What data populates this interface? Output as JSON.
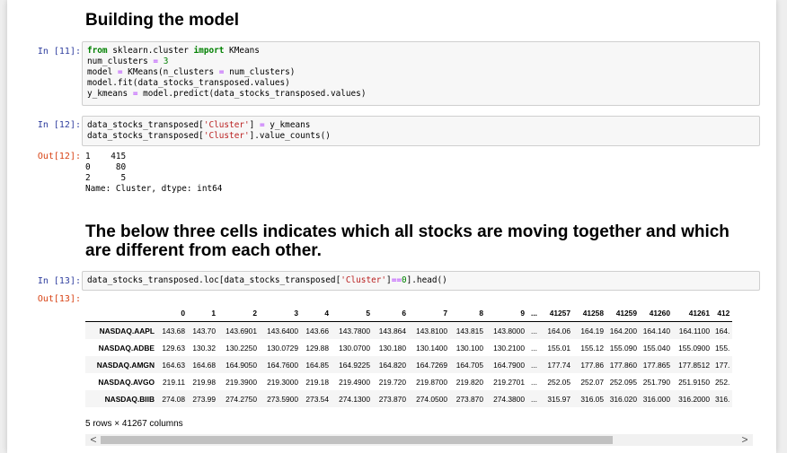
{
  "headings": {
    "building_model": "Building the model",
    "below_three_cells": "The below three cells indicates which all stocks are moving together and which are different from each other."
  },
  "cells": {
    "c11": {
      "prompt": "In [11]:",
      "line1": {
        "kw1": "from",
        "mod": " sklearn.cluster ",
        "kw2": "import",
        "name": " KMeans"
      },
      "line2": {
        "pre": "num_clusters ",
        "op": "=",
        "sp": " ",
        "num": "3"
      },
      "line3": {
        "pre": "model ",
        "op": "=",
        "rest": " KMeans(n_clusters ",
        "op2": "=",
        "rest2": " num_clusters)"
      },
      "line4": "model.fit(data_stocks_transposed.values)",
      "line5": {
        "pre": "y_kmeans ",
        "op": "=",
        "rest": " model.predict(data_stocks_transposed.values)"
      }
    },
    "c12": {
      "prompt": "In [12]:",
      "line1": {
        "pre": "data_stocks_transposed[",
        "str": "'Cluster'",
        "mid": "] ",
        "op": "=",
        "rest": " y_kmeans"
      },
      "line2": {
        "pre": "data_stocks_transposed[",
        "str": "'Cluster'",
        "rest": "].value_counts()"
      },
      "out_prompt": "Out[12]:",
      "output": "1    415\n0     80\n2      5\nName: Cluster, dtype: int64"
    },
    "c13": {
      "prompt": "In [13]:",
      "line1": {
        "pre": "data_stocks_transposed.loc[data_stocks_transposed[",
        "str": "'Cluster'",
        "mid": "]",
        "op": "==",
        "num": "0",
        "rest": "].head()"
      },
      "out_prompt": "Out[13]:"
    }
  },
  "dataframe": {
    "columns": [
      "",
      "0",
      "1",
      "2",
      "3",
      "4",
      "5",
      "6",
      "7",
      "8",
      "9",
      "...",
      "41257",
      "41258",
      "41259",
      "41260",
      "41261",
      "412"
    ],
    "rows": [
      [
        "NASDAQ.AAPL",
        "143.68",
        "143.70",
        "143.6901",
        "143.6400",
        "143.66",
        "143.7800",
        "143.864",
        "143.8100",
        "143.815",
        "143.8000",
        "...",
        "164.06",
        "164.19",
        "164.200",
        "164.140",
        "164.1100",
        "164."
      ],
      [
        "NASDAQ.ADBE",
        "129.63",
        "130.32",
        "130.2250",
        "130.0729",
        "129.88",
        "130.0700",
        "130.180",
        "130.1400",
        "130.100",
        "130.2100",
        "...",
        "155.01",
        "155.12",
        "155.090",
        "155.040",
        "155.0900",
        "155."
      ],
      [
        "NASDAQ.AMGN",
        "164.63",
        "164.68",
        "164.9050",
        "164.7600",
        "164.85",
        "164.9225",
        "164.820",
        "164.7269",
        "164.705",
        "164.7900",
        "...",
        "177.74",
        "177.86",
        "177.860",
        "177.865",
        "177.8512",
        "177."
      ],
      [
        "NASDAQ.AVGO",
        "219.11",
        "219.98",
        "219.3900",
        "219.3000",
        "219.18",
        "219.4900",
        "219.720",
        "219.8700",
        "219.820",
        "219.2701",
        "...",
        "252.05",
        "252.07",
        "252.095",
        "251.790",
        "251.9150",
        "252."
      ],
      [
        "NASDAQ.BIIB",
        "274.08",
        "273.99",
        "274.2750",
        "273.5900",
        "273.54",
        "274.1300",
        "273.870",
        "274.0500",
        "273.870",
        "274.3800",
        "...",
        "315.97",
        "316.05",
        "316.020",
        "316.000",
        "316.2000",
        "316."
      ]
    ],
    "shape_text": "5 rows × 41267 columns"
  },
  "scrollbar": {
    "left_arrow": "<",
    "right_arrow": ">"
  }
}
